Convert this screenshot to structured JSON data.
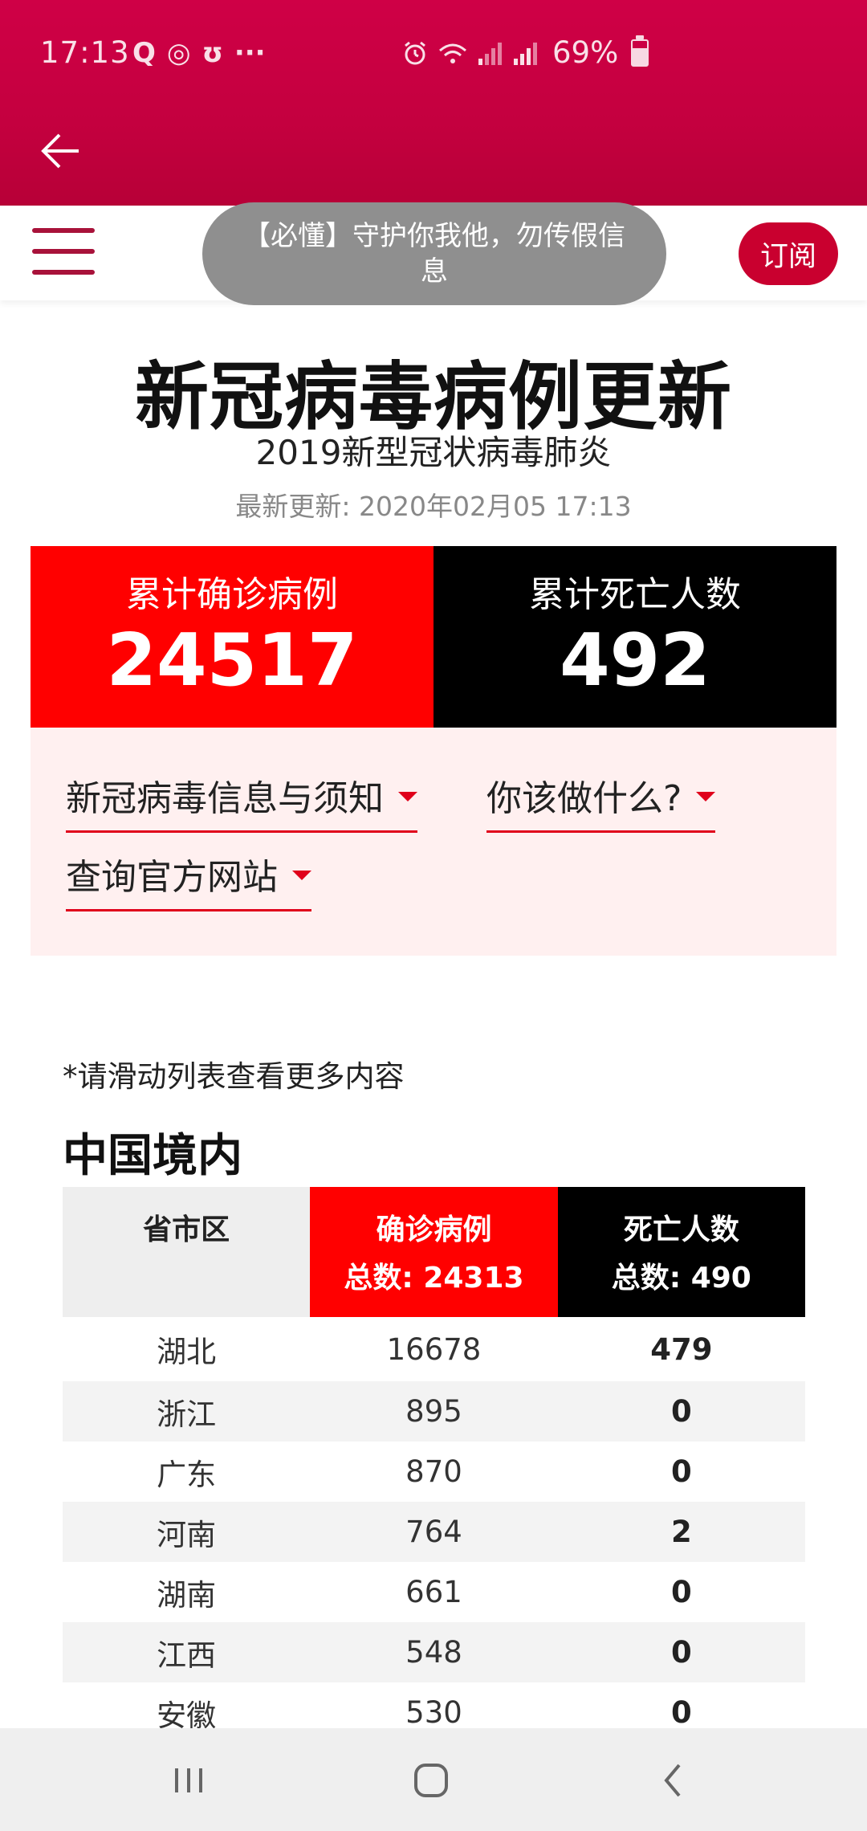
{
  "status_bar": {
    "time": "17:13",
    "battery": "69%",
    "app_icons": [
      "Q",
      "◎",
      "ʊ",
      "···"
    ],
    "right_icons": [
      "alarm-icon",
      "wifi-icon",
      "signal-icon",
      "signal-icon"
    ]
  },
  "toast": {
    "text": "【必懂】守护你我他，勿传假信息"
  },
  "navbar": {
    "subscribe_label": "订阅"
  },
  "header": {
    "title": "新冠病毒病例更新",
    "subtitle": "2019新型冠状病毒肺炎",
    "last_updated": "最新更新: 2020年02月05 17:13"
  },
  "totals": {
    "confirmed_label": "累计确诊病例",
    "confirmed_value": "24517",
    "deaths_label": "累计死亡人数",
    "deaths_value": "492"
  },
  "info_links": [
    {
      "label": "新冠病毒信息与须知"
    },
    {
      "label": "你该做什么?"
    },
    {
      "label": "查询官方网站"
    }
  ],
  "china": {
    "scroll_hint": "*请滑动列表查看更多内容",
    "section_title": "中国境内",
    "columns": {
      "region": "省市区",
      "confirmed_title": "确诊病例",
      "confirmed_total": "总数: 24313",
      "deaths_title": "死亡人数",
      "deaths_total": "总数: 490"
    },
    "rows": [
      {
        "region": "湖北",
        "confirmed": "16678",
        "deaths": "479"
      },
      {
        "region": "浙江",
        "confirmed": "895",
        "deaths": "0"
      },
      {
        "region": "广东",
        "confirmed": "870",
        "deaths": "0"
      },
      {
        "region": "河南",
        "confirmed": "764",
        "deaths": "2"
      },
      {
        "region": "湖南",
        "confirmed": "661",
        "deaths": "0"
      },
      {
        "region": "江西",
        "confirmed": "548",
        "deaths": "0"
      },
      {
        "region": "安徽",
        "confirmed": "530",
        "deaths": "0"
      }
    ]
  },
  "colors": {
    "app_bar": "#c4003f",
    "confirmed": "#ff0000",
    "deaths": "#000000",
    "accent": "#e0001b",
    "panel_bg": "#fff0f0"
  }
}
